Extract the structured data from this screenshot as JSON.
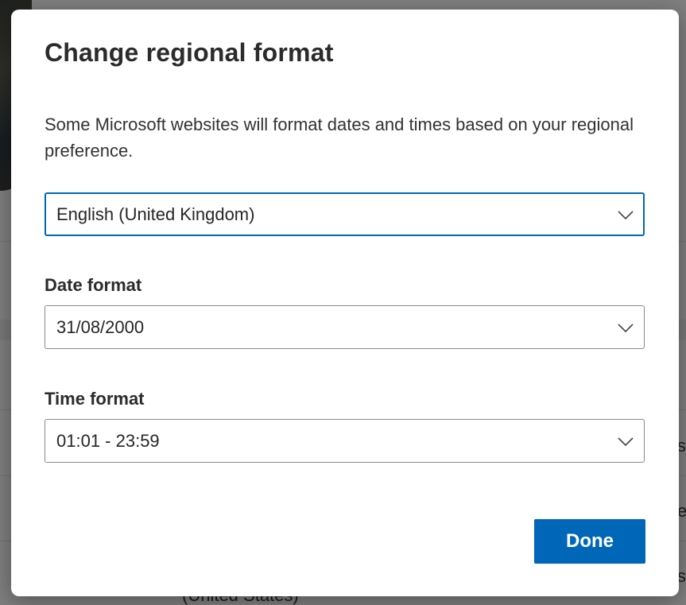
{
  "background": {
    "fragments": [
      "s",
      "e",
      "s"
    ],
    "bottom_text": "(United States)"
  },
  "dialog": {
    "title": "Change regional format",
    "description": "Some Microsoft websites will format dates and times based on your regional preference.",
    "region_select": {
      "value": "English (United Kingdom)",
      "icon": "chevron-down-icon"
    },
    "date_format": {
      "label": "Date format",
      "value": "31/08/2000",
      "icon": "chevron-down-icon"
    },
    "time_format": {
      "label": "Time format",
      "value": "01:01 - 23:59",
      "icon": "chevron-down-icon"
    },
    "done_label": "Done"
  },
  "colors": {
    "accent": "#0067b8",
    "overlay": "rgba(0,0,0,0.48)"
  }
}
